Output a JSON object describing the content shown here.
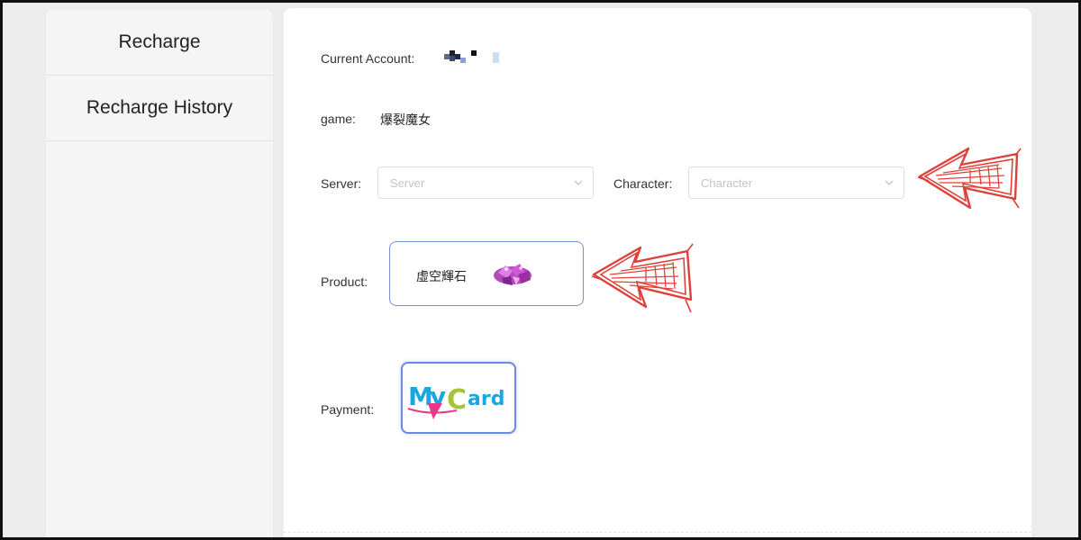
{
  "sidebar": {
    "items": [
      {
        "label": "Recharge"
      },
      {
        "label": "Recharge History"
      }
    ]
  },
  "form": {
    "account": {
      "label": "Current Account:"
    },
    "game": {
      "label": "game:",
      "value": "爆裂魔女"
    },
    "server": {
      "label": "Server:",
      "placeholder": "Server"
    },
    "character": {
      "label": "Character:",
      "placeholder": "Character"
    },
    "product": {
      "label": "Product:",
      "name": "虛空輝石",
      "icon": "gem-icon"
    },
    "payment": {
      "label": "Payment:",
      "method": "MyCard"
    }
  },
  "colors": {
    "accent_border": "#6c87e8",
    "annotation_arrow": "#e0403a",
    "sidebar_bg": "#f5f5f5",
    "page_bg": "#ececec"
  }
}
